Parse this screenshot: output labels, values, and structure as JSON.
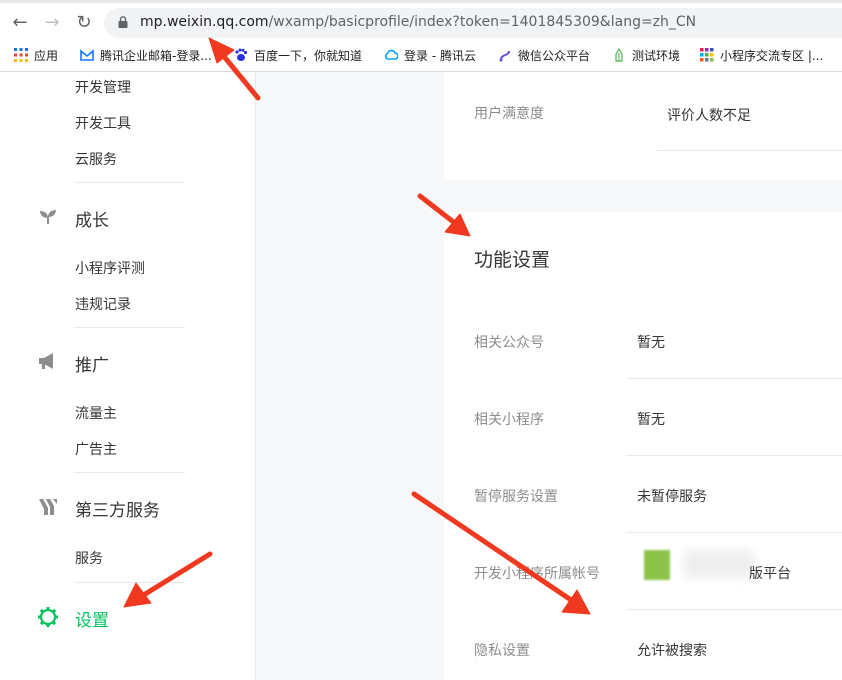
{
  "browser": {
    "url_host": "mp.weixin.qq.com",
    "url_rest": "/wxamp/basicprofile/index?token=1401845309&lang=zh_CN",
    "bookmarks": [
      {
        "label": "应用",
        "icon": "apps-grid-icon"
      },
      {
        "label": "腾讯企业邮箱-登录...",
        "icon": "tencent-mail-icon"
      },
      {
        "label": "百度一下，你就知道",
        "icon": "baidu-paw-icon"
      },
      {
        "label": "登录 - 腾讯云",
        "icon": "tencent-cloud-icon"
      },
      {
        "label": "微信公众平台",
        "icon": "wechat-platform-icon"
      },
      {
        "label": "测试环境",
        "icon": "test-env-icon"
      },
      {
        "label": "小程序交流专区 |...",
        "icon": "miniprogram-community-icon"
      }
    ]
  },
  "sidebar": {
    "dev_items": [
      "开发管理",
      "开发工具",
      "云服务"
    ],
    "growth": {
      "title": "成长",
      "items": [
        "小程序评测",
        "违规记录"
      ]
    },
    "promo": {
      "title": "推广",
      "items": [
        "流量主",
        "广告主"
      ]
    },
    "third": {
      "title": "第三方服务",
      "items": [
        "服务"
      ]
    },
    "settings": {
      "title": "设置"
    }
  },
  "main": {
    "satisfaction": {
      "label": "用户满意度",
      "value": "评价人数不足"
    },
    "feature": {
      "title": "功能设置",
      "rows": [
        {
          "label": "相关公众号",
          "value": "暂无"
        },
        {
          "label": "相关小程序",
          "value": "暂无"
        },
        {
          "label": "暂停服务设置",
          "value": "未暂停服务"
        },
        {
          "label": "开发小程序所属帐号",
          "value": "版平台"
        },
        {
          "label": "隐私设置",
          "value": "允许被搜索"
        }
      ]
    }
  },
  "colors": {
    "accent": "#07c160",
    "arrow": "#f0391f"
  }
}
